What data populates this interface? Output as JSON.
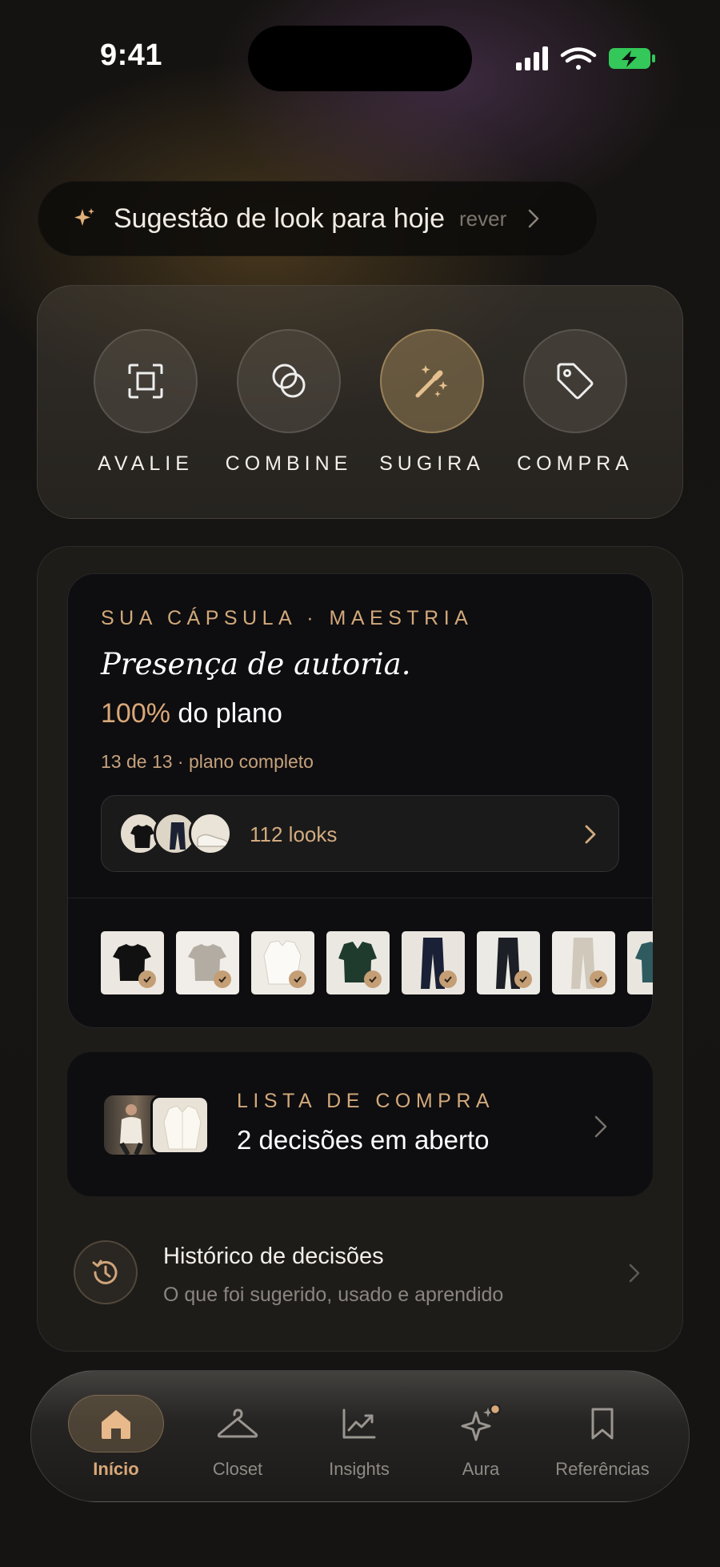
{
  "status_bar": {
    "time": "9:41"
  },
  "suggestion": {
    "title": "Sugestão de look para hoje",
    "action": "rever",
    "icon": "sparkle-icon"
  },
  "actions": [
    {
      "label": "AVALIE",
      "icon": "scan-icon",
      "active": false
    },
    {
      "label": "COMBINE",
      "icon": "overlap-circles-icon",
      "active": false
    },
    {
      "label": "SUGIRA",
      "icon": "magic-wand-icon",
      "active": true
    },
    {
      "label": "COMPRA",
      "icon": "tag-icon",
      "active": false
    }
  ],
  "capsule": {
    "kicker": "SUA CÁPSULA · MAESTRIA",
    "headline": "Presença de autoria.",
    "percent": "100%",
    "percent_suffix": " do plano",
    "progress_text": "13 de 13 · plano completo",
    "looks_label": "112 looks",
    "look_thumbs": [
      "black t-shirt",
      "navy trousers",
      "white sneakers"
    ],
    "items": [
      "black t-shirt",
      "grey t-shirt",
      "white shirt",
      "green polo",
      "navy trousers",
      "dark trousers",
      "beige trousers",
      "teal top"
    ]
  },
  "shopping": {
    "kicker": "LISTA DE COMPRA",
    "title": "2 decisões em aberto"
  },
  "history": {
    "title": "Histórico de decisões",
    "subtitle": "O que foi sugerido, usado e aprendido",
    "icon": "history-icon"
  },
  "tabs": [
    {
      "label": "Início",
      "icon": "home-icon",
      "active": true
    },
    {
      "label": "Closet",
      "icon": "hanger-icon",
      "active": false
    },
    {
      "label": "Insights",
      "icon": "chart-icon",
      "active": false
    },
    {
      "label": "Aura",
      "icon": "sparkle-icon",
      "active": false
    },
    {
      "label": "Referências",
      "icon": "bookmark-icon",
      "active": false
    }
  ],
  "colors": {
    "accent": "#d9a878",
    "background": "#161412",
    "card": "#0e0d10"
  }
}
